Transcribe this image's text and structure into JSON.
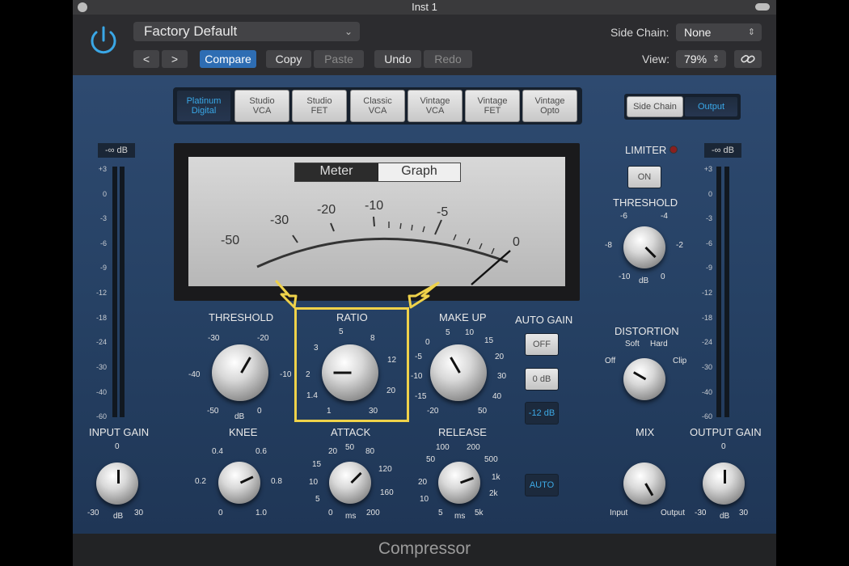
{
  "window": {
    "title": "Inst 1"
  },
  "header": {
    "preset": "Factory Default",
    "prev": "<",
    "next": ">",
    "compare": "Compare",
    "copy": "Copy",
    "paste": "Paste",
    "undo": "Undo",
    "redo": "Redo",
    "side_chain_label": "Side Chain:",
    "side_chain_value": "None",
    "view_label": "View:",
    "view_value": "79%",
    "link_icon": "link-icon"
  },
  "models": [
    {
      "l1": "Platinum",
      "l2": "Digital"
    },
    {
      "l1": "Studio",
      "l2": "VCA"
    },
    {
      "l1": "Studio",
      "l2": "FET"
    },
    {
      "l1": "Classic",
      "l2": "VCA"
    },
    {
      "l1": "Vintage",
      "l2": "VCA"
    },
    {
      "l1": "Vintage",
      "l2": "FET"
    },
    {
      "l1": "Vintage",
      "l2": "Opto"
    }
  ],
  "routing": {
    "side_chain": "Side Chain",
    "output": "Output"
  },
  "meter": {
    "tab_meter": "Meter",
    "tab_graph": "Graph",
    "scale": [
      "-50",
      "-30",
      "-20",
      "-10",
      "-5",
      "0"
    ]
  },
  "input_meter": {
    "readout": "-∞ dB",
    "scale": [
      "+3",
      "0",
      "-3",
      "-6",
      "-9",
      "-12",
      "-18",
      "-24",
      "-30",
      "-40",
      "-60"
    ]
  },
  "output_meter": {
    "readout": "-∞ dB",
    "scale": [
      "+3",
      "0",
      "-3",
      "-6",
      "-9",
      "-12",
      "-18",
      "-24",
      "-30",
      "-40",
      "-60"
    ]
  },
  "threshold": {
    "label": "THRESHOLD",
    "ticks": [
      "-30",
      "-20",
      "-40",
      "-10",
      "-50",
      "0"
    ],
    "unit": "dB"
  },
  "ratio": {
    "label": "RATIO",
    "ticks": [
      "5",
      "8",
      "3",
      "12",
      "2",
      "20",
      "1.4",
      "1",
      "30"
    ]
  },
  "makeup": {
    "label": "MAKE UP",
    "ticks": [
      "5",
      "10",
      "15",
      "0",
      "20",
      "-5",
      "30",
      "-10",
      "40",
      "-15",
      "-20",
      "50"
    ]
  },
  "auto_gain": {
    "label": "AUTO GAIN",
    "off": "OFF",
    "zero": "0 dB",
    "minus12": "-12 dB"
  },
  "knee": {
    "label": "KNEE",
    "ticks": [
      "0.4",
      "0.6",
      "0.2",
      "0.8",
      "0",
      "1.0"
    ]
  },
  "attack": {
    "label": "ATTACK",
    "ticks": [
      "20",
      "50",
      "80",
      "15",
      "120",
      "10",
      "160",
      "5",
      "0",
      "200"
    ],
    "unit": "ms"
  },
  "release": {
    "label": "RELEASE",
    "ticks": [
      "100",
      "200",
      "50",
      "500",
      "20",
      "1k",
      "10",
      "2k",
      "5",
      "5k"
    ],
    "unit": "ms"
  },
  "auto_btn": "AUTO",
  "input_gain": {
    "label": "INPUT GAIN",
    "ticks": [
      "0",
      "-30",
      "30"
    ],
    "unit": "dB"
  },
  "limiter": {
    "label": "LIMITER",
    "on": "ON"
  },
  "lim_threshold": {
    "label": "THRESHOLD",
    "ticks": [
      "-6",
      "-4",
      "-8",
      "-2",
      "-10",
      "0"
    ],
    "unit": "dB"
  },
  "distortion": {
    "label": "DISTORTION",
    "soft": "Soft",
    "hard": "Hard",
    "off": "Off",
    "clip": "Clip"
  },
  "mix": {
    "label": "MIX",
    "input": "Input",
    "output": "Output"
  },
  "output_gain": {
    "label": "OUTPUT GAIN",
    "ticks": [
      "0",
      "-30",
      "30"
    ],
    "unit": "dB"
  },
  "footer": {
    "name": "Compressor"
  },
  "colors": {
    "accent": "#3aa7e6",
    "highlight": "#efd24a",
    "panel": "#2a4568"
  }
}
